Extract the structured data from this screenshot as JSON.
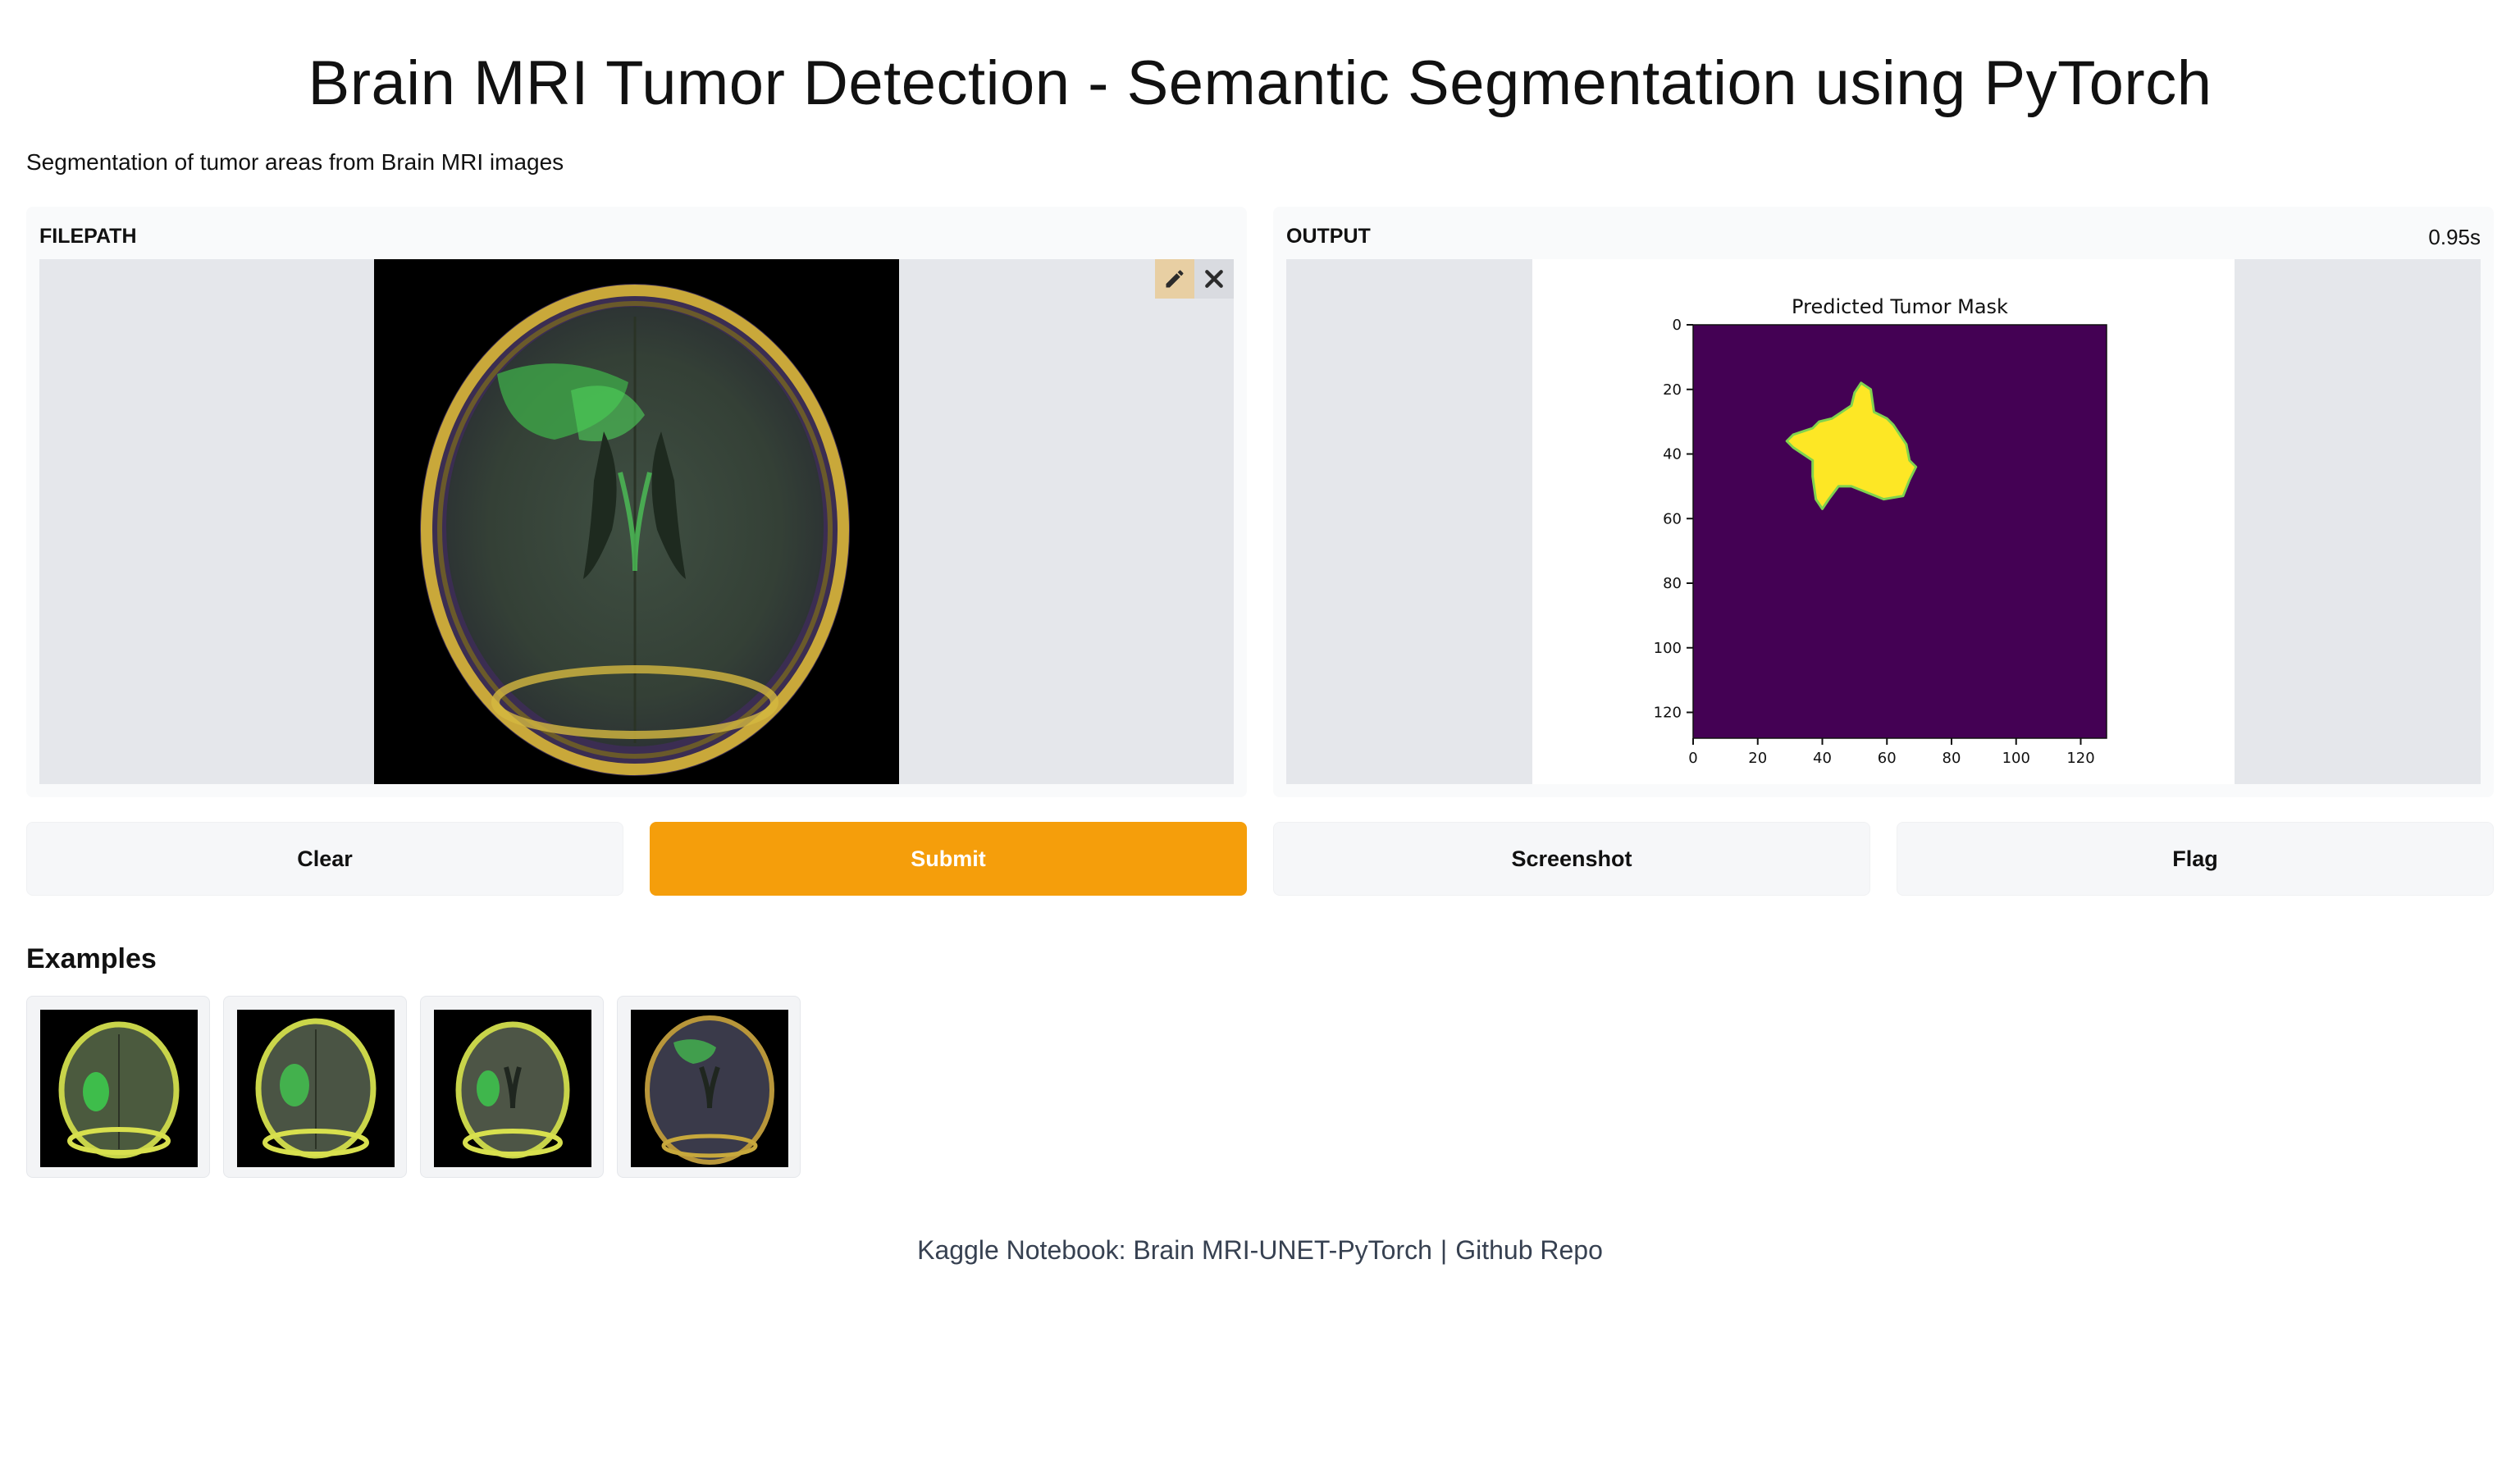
{
  "page": {
    "title": "Brain MRI Tumor Detection - Semantic Segmentation using PyTorch",
    "subtitle": "Segmentation of tumor areas from Brain MRI images"
  },
  "input_panel": {
    "label": "FILEPATH",
    "tools": [
      "pencil-icon",
      "close-icon"
    ]
  },
  "output_panel": {
    "label": "OUTPUT",
    "timing": "0.95s"
  },
  "buttons": {
    "clear": "Clear",
    "submit": "Submit",
    "screenshot": "Screenshot",
    "flag": "Flag"
  },
  "examples": {
    "title": "Examples",
    "count": 4
  },
  "footer": {
    "kaggle_link": "Kaggle Notebook: Brain MRI-UNET-PyTorch",
    "separator": "|",
    "github_link": "Github Repo"
  },
  "colors": {
    "accent": "#f59e0b",
    "panel_bg": "#f9fafb",
    "image_bg": "#e5e7eb",
    "mask_background": "#440154",
    "mask_foreground": "#fde725"
  },
  "chart_data": {
    "type": "heatmap",
    "title": "Predicted Tumor Mask",
    "xlabel": "",
    "ylabel": "",
    "xlim": [
      0,
      128
    ],
    "ylim": [
      128,
      0
    ],
    "xticks": [
      0,
      20,
      40,
      60,
      80,
      100,
      120
    ],
    "yticks": [
      0,
      20,
      40,
      60,
      80,
      100,
      120
    ],
    "tumor_region": {
      "value": 1,
      "outline": [
        [
          52,
          18
        ],
        [
          55,
          20
        ],
        [
          56,
          27
        ],
        [
          60,
          29
        ],
        [
          62,
          31
        ],
        [
          64,
          34
        ],
        [
          66,
          37
        ],
        [
          67,
          42
        ],
        [
          69,
          44
        ],
        [
          67,
          48
        ],
        [
          65,
          53
        ],
        [
          59,
          54
        ],
        [
          54,
          52
        ],
        [
          49,
          50
        ],
        [
          45,
          50
        ],
        [
          42,
          54
        ],
        [
          40,
          57
        ],
        [
          38,
          54
        ],
        [
          37,
          47
        ],
        [
          37,
          42
        ],
        [
          34,
          40
        ],
        [
          31,
          38
        ],
        [
          29,
          36
        ],
        [
          31,
          34
        ],
        [
          34,
          33
        ],
        [
          37,
          32
        ],
        [
          39,
          30
        ],
        [
          43,
          29
        ],
        [
          46,
          27
        ],
        [
          49,
          25
        ],
        [
          50,
          21
        ]
      ]
    }
  }
}
